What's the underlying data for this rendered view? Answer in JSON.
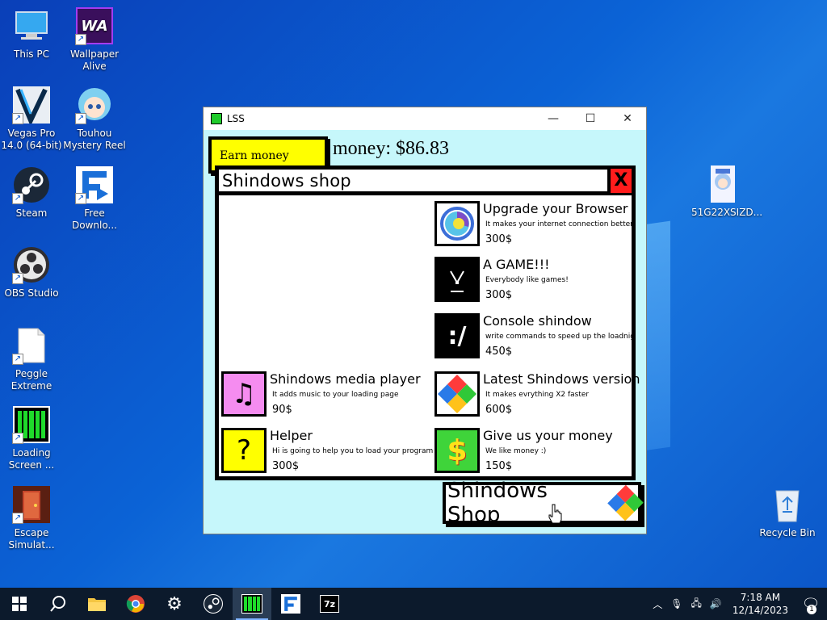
{
  "desktop": {
    "icons": [
      {
        "label": "This PC",
        "icon": "computer-icon"
      },
      {
        "label": "Wallpaper Alive",
        "icon": "wallpaper-alive-icon"
      },
      {
        "label": "Vegas Pro 14.0 (64-bit)",
        "icon": "vegas-pro-icon"
      },
      {
        "label": "Touhou Mystery Reel",
        "icon": "touhou-icon"
      },
      {
        "label": "Steam",
        "icon": "steam-icon"
      },
      {
        "label": "Free Downlo...",
        "icon": "free-download-icon"
      },
      {
        "label": "OBS Studio",
        "icon": "obs-icon"
      },
      {
        "label": "Peggle Extreme",
        "icon": "file-icon"
      },
      {
        "label": "Loading Screen ...",
        "icon": "loading-screen-icon"
      },
      {
        "label": "Escape Simulat...",
        "icon": "escape-simulator-icon"
      },
      {
        "label": "51G22XSIZD...",
        "icon": "image-file-icon"
      },
      {
        "label": "Recycle Bin",
        "icon": "recycle-bin-icon"
      }
    ],
    "wa_text": "WA",
    "loading_file_char": "7z"
  },
  "window": {
    "title": "LSS",
    "minimize": "—",
    "maximize": "☐",
    "close": "✕"
  },
  "game": {
    "earn_label": "Earn money",
    "money_text": "money: $86.83",
    "shop_title": "Shindows shop",
    "shop_close": "X",
    "shop_button_label": "Shindows Shop",
    "items": [
      {
        "name": "Upgrade your Browser",
        "desc": "It makes your internet connection better",
        "price": "300$",
        "icon": "browser-icon"
      },
      {
        "name": "A GAME!!!",
        "desc": "Everybody like games!",
        "price": "300$",
        "icon": "game-icon"
      },
      {
        "name": "Console shindow",
        "desc": "write commands to speed up the loadnig",
        "price": "450$",
        "icon": "console-icon",
        "glyph": ":/"
      },
      {
        "name": "Shindows media player",
        "desc": "It adds music to your loading page",
        "price": "90$",
        "icon": "music-note-icon",
        "glyph": "♫"
      },
      {
        "name": "Latest Shindows version",
        "desc": "It makes evrything X2 faster",
        "price": "600$",
        "icon": "shindows-logo-icon"
      },
      {
        "name": "Helper",
        "desc": "Hi is going to help you to load your program",
        "price": "300$",
        "icon": "question-icon",
        "glyph": "?"
      },
      {
        "name": "Give us your money",
        "desc": "We like money :)",
        "price": "150$",
        "icon": "dollar-icon",
        "glyph": "$"
      }
    ]
  },
  "taskbar": {
    "time": "7:18 AM",
    "date": "12/14/2023",
    "notification_count": "1",
    "sevenzip_label": "7z"
  }
}
